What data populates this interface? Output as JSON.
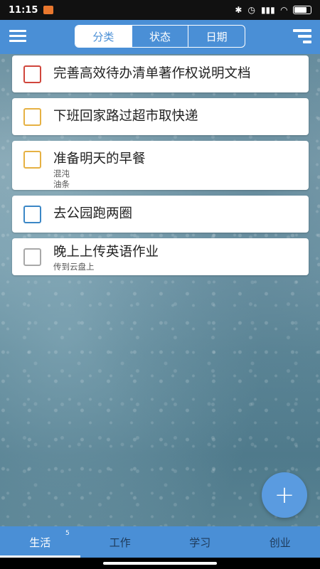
{
  "status_bar": {
    "time": "11:15",
    "battery_icon": "battery-icon",
    "icons": [
      "bluetooth-icon",
      "alarm-icon",
      "signal-icon",
      "wifi-icon"
    ]
  },
  "header": {
    "segments": [
      {
        "label": "分类",
        "active": true
      },
      {
        "label": "状态",
        "active": false
      },
      {
        "label": "日期",
        "active": false
      }
    ],
    "menu_icon": "hamburger-menu-icon",
    "sort_icon": "sort-icon"
  },
  "tasks": [
    {
      "title": "完善高效待办清单著作权说明文档",
      "notes": [],
      "checkbox_color": "#d0463c"
    },
    {
      "title": "下班回家路过超市取快递",
      "notes": [],
      "checkbox_color": "#e6b143"
    },
    {
      "title": "准备明天的早餐",
      "notes": [
        "混沌",
        "油条"
      ],
      "checkbox_color": "#e6b143"
    },
    {
      "title": "去公园跑两圈",
      "notes": [],
      "checkbox_color": "#3b87c6"
    },
    {
      "title": "晚上上传英语作业",
      "notes": [
        "传到云盘上"
      ],
      "checkbox_color": "#a8a8a8"
    }
  ],
  "fab": {
    "label": "+",
    "icon": "plus-icon"
  },
  "tabs": [
    {
      "label": "生活",
      "badge": "5",
      "active": true
    },
    {
      "label": "工作",
      "active": false
    },
    {
      "label": "学习",
      "active": false
    },
    {
      "label": "创业",
      "active": false
    }
  ],
  "colors": {
    "accent": "#4a8fd6",
    "fab": "#5a9be0"
  }
}
